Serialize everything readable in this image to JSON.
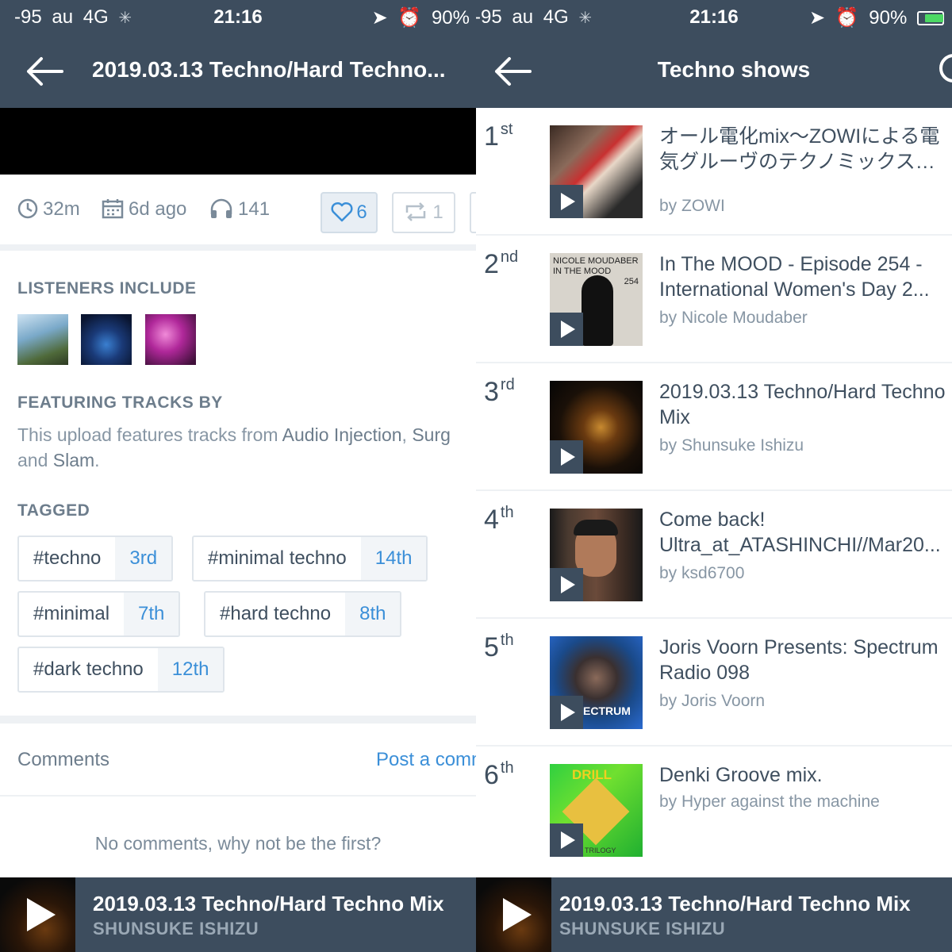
{
  "status_bar": {
    "signal": "-95",
    "carrier": "au",
    "network": "4G",
    "time": "21:16",
    "battery": "90%",
    "battery_level": 0.9
  },
  "left": {
    "nav_title": "2019.03.13 Techno/Hard Techno...",
    "stats": {
      "duration": "32m",
      "uploaded": "6d ago",
      "plays": "141",
      "likes": "6",
      "reposts": "1"
    },
    "listeners_label": "LISTENERS INCLUDE",
    "featuring_label": "FEATURING TRACKS BY",
    "featuring_text_prefix": "This upload features tracks from",
    "featuring_artist_1": "Audio Injection",
    "featuring_artist_2": "Surg",
    "featuring_and": "and",
    "featuring_artist_3": "Slam",
    "tagged_label": "TAGGED",
    "tags": [
      {
        "name": "#techno",
        "rank": "3rd"
      },
      {
        "name": "#minimal techno",
        "rank": "14th"
      },
      {
        "name": "#minimal",
        "rank": "7th"
      },
      {
        "name": "#hard techno",
        "rank": "8th"
      },
      {
        "name": "#dark techno",
        "rank": "12th"
      }
    ],
    "comments_label": "Comments",
    "post_comment": "Post a comm",
    "no_comments": "No comments, why not be the first?"
  },
  "right": {
    "nav_title": "Techno shows",
    "ranks": [
      {
        "num": "1",
        "suffix": "st",
        "title": "オール電化mix〜ZOWIによる電気グルーヴのテクノミックス…",
        "by": "by ZOWI"
      },
      {
        "num": "2",
        "suffix": "nd",
        "title": "In The MOOD - Episode 254 - International Women's Day 2...",
        "by": "by Nicole Moudaber",
        "thumb_text_1": "NICOLE MOUDABER",
        "thumb_text_2": "IN THE MOOD",
        "thumb_text_3": "254"
      },
      {
        "num": "3",
        "suffix": "rd",
        "title": "2019.03.13 Techno/Hard Techno Mix",
        "by": "by Shunsuke Ishizu"
      },
      {
        "num": "4",
        "suffix": "th",
        "title": "Come back! Ultra_at_ATASHINCHI//Mar20...",
        "by": "by ksd6700"
      },
      {
        "num": "5",
        "suffix": "th",
        "title": "Joris Voorn Presents: Spectrum Radio 098",
        "by": "by Joris Voorn",
        "thumb_text_1": "ECTRUM"
      },
      {
        "num": "6",
        "suffix": "th",
        "title": "Denki Groove mix.",
        "by": "by Hyper against the machine",
        "thumb_text_1": "DRILL",
        "thumb_text_2": "TRILOGY"
      }
    ]
  },
  "player": {
    "title": "2019.03.13 Techno/Hard Techno Mix",
    "artist": "SHUNSUKE ISHIZU"
  },
  "colors": {
    "header_bg": "#3d4d5e",
    "accent": "#3b8fd8"
  }
}
